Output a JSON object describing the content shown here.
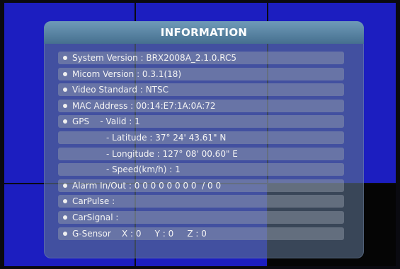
{
  "panel": {
    "title": "INFORMATION",
    "rows": [
      {
        "text": "System Version : BRX2008A_2.1.0.RC5",
        "bullet": true
      },
      {
        "text": "Micom Version : 0.3.1(18)",
        "bullet": true
      },
      {
        "text": "Video Standard : NTSC",
        "bullet": true
      },
      {
        "text": "MAC Address : 00:14:E7:1A:0A:72",
        "bullet": true
      },
      {
        "text": "GPS    - Valid : 1",
        "bullet": true
      },
      {
        "text": "- Latitude : 37° 24' 43.61\" N",
        "bullet": false
      },
      {
        "text": "- Longitude : 127° 08' 00.60\" E",
        "bullet": false
      },
      {
        "text": "- Speed(km/h) : 1",
        "bullet": false
      },
      {
        "text": "Alarm In/Out : 0 0 0 0 0 0 0 0  / 0 0",
        "bullet": true
      },
      {
        "text": "CarPulse :",
        "bullet": true
      },
      {
        "text": "CarSignal :",
        "bullet": true
      },
      {
        "text": "G-Sensor    X : 0     Y : 0     Z : 0",
        "bullet": true
      }
    ]
  },
  "colors": {
    "camera_background": "#1c1ec0",
    "panel_background": "#5a708c",
    "title_bar": "#46708f",
    "text": "#f4f4f4"
  }
}
